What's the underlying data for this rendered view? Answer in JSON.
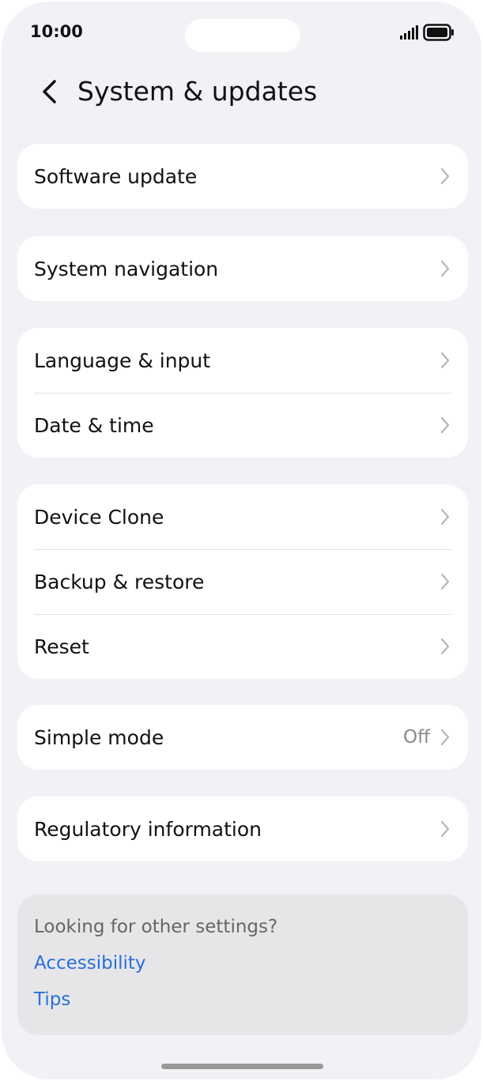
{
  "status_bar": {
    "time": "10:00",
    "icons": [
      "signal-icon",
      "battery-icon"
    ]
  },
  "header": {
    "back_icon": "chevron-left-icon",
    "title": "System & updates"
  },
  "groups": [
    {
      "items": [
        {
          "label": "Software update",
          "value": ""
        }
      ]
    },
    {
      "items": [
        {
          "label": "System navigation",
          "value": ""
        }
      ]
    },
    {
      "items": [
        {
          "label": "Language & input",
          "value": ""
        },
        {
          "label": "Date & time",
          "value": ""
        }
      ]
    },
    {
      "items": [
        {
          "label": "Device Clone",
          "value": ""
        },
        {
          "label": "Backup & restore",
          "value": ""
        },
        {
          "label": "Reset",
          "value": ""
        }
      ]
    },
    {
      "items": [
        {
          "label": "Simple mode",
          "value": "Off"
        }
      ]
    },
    {
      "items": [
        {
          "label": "Regulatory information",
          "value": ""
        }
      ]
    }
  ],
  "footer": {
    "question": "Looking for other settings?",
    "links": [
      "Accessibility",
      "Tips"
    ]
  },
  "colors": {
    "background": "#f1f2f6",
    "card": "#ffffff",
    "link": "#2a6fdb",
    "footer_card": "#e6e6e9"
  }
}
